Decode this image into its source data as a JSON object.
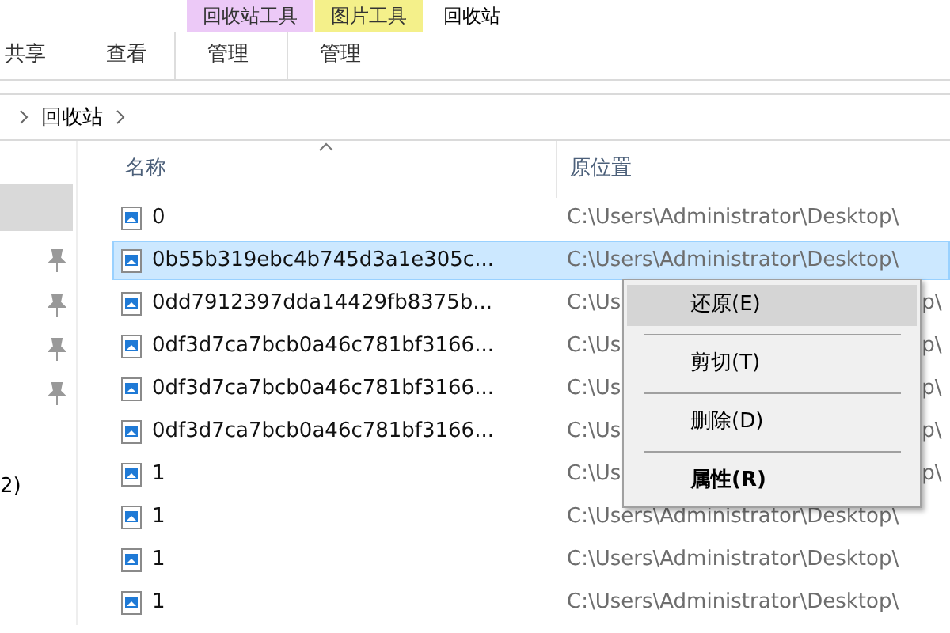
{
  "context_tabs": [
    {
      "label": "回收站工具",
      "color": "#ecc9f7"
    },
    {
      "label": "图片工具",
      "color": "#f4f08a"
    }
  ],
  "window": {
    "title": "回收站"
  },
  "ribbon_tabs": [
    {
      "label": "共享",
      "kind": "plain"
    },
    {
      "label": "查看",
      "kind": "plain"
    },
    {
      "label": "管理",
      "kind": "context"
    },
    {
      "label": "管理",
      "kind": "context"
    }
  ],
  "breadcrumb": [
    "回收站"
  ],
  "sidebar": {
    "fragment": "2)"
  },
  "columns": [
    "名称",
    "原位置"
  ],
  "rows": [
    {
      "name": "0",
      "location": "C:\\Users\\Administrator\\Desktop\\",
      "selected": false
    },
    {
      "name": "0b55b319ebc4b745d3a1e305c...",
      "location": "C:\\Users\\Administrator\\Desktop\\",
      "selected": true
    },
    {
      "name": "0dd7912397dda14429fb8375b...",
      "location": "C:\\Us",
      "location_end": "p\\",
      "selected": false
    },
    {
      "name": "0df3d7ca7bcb0a46c781bf3166...",
      "location": "C:\\Us",
      "location_end": "p\\",
      "selected": false
    },
    {
      "name": "0df3d7ca7bcb0a46c781bf3166...",
      "location": "C:\\Us",
      "location_end": "p\\",
      "selected": false
    },
    {
      "name": "0df3d7ca7bcb0a46c781bf3166...",
      "location": "C:\\Us",
      "location_end": "p\\",
      "selected": false
    },
    {
      "name": "1",
      "location": "C:\\Us",
      "location_end": "p\\",
      "selected": false
    },
    {
      "name": "1",
      "location": "C:\\Users\\Administrator\\Desktop\\",
      "selected": false
    },
    {
      "name": "1",
      "location": "C:\\Users\\Administrator\\Desktop\\",
      "selected": false
    },
    {
      "name": "1",
      "location": "C:\\Users\\Administrator\\Desktop\\",
      "selected": false
    }
  ],
  "context_menu": [
    {
      "label": "还原(E)",
      "selected": true,
      "bold": false
    },
    {
      "label": "剪切(T)",
      "selected": false,
      "bold": false
    },
    {
      "label": "删除(D)",
      "selected": false,
      "bold": false
    },
    {
      "label": "属性(R)",
      "selected": false,
      "bold": true
    }
  ]
}
